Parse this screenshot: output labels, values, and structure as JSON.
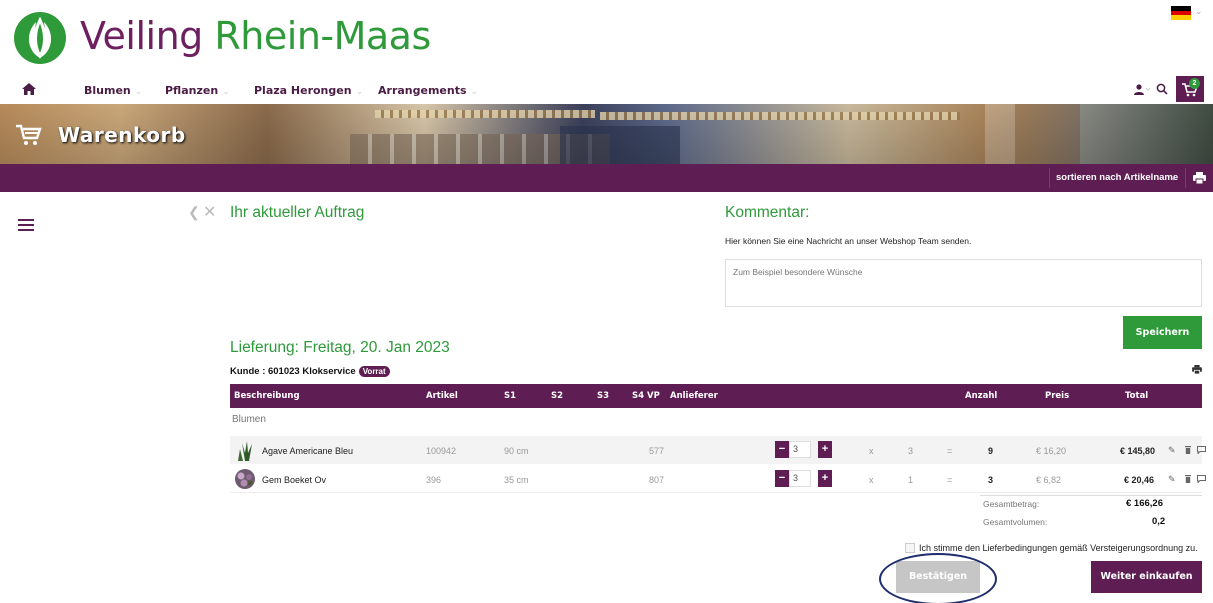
{
  "brand": {
    "part1": "Veiling ",
    "part2": "Rhein-Maas"
  },
  "nav": {
    "items": [
      {
        "label": "Blumen"
      },
      {
        "label": "Pflanzen"
      },
      {
        "label": "Plaza Herongen"
      },
      {
        "label": "Arrangements"
      }
    ],
    "cart_count": "2",
    "icons": [
      "home-icon",
      "user-icon",
      "search-icon",
      "cart-icon",
      "flag-de-icon"
    ]
  },
  "banner": {
    "title": "Warenkorb"
  },
  "toolbar": {
    "sort_label": "sortieren nach Artikelname"
  },
  "order": {
    "title": "Ihr aktueller Auftrag"
  },
  "comment": {
    "title": "Kommentar:",
    "hint": "Hier können Sie eine Nachricht an unser Webshop Team senden.",
    "placeholder": "Zum Beispiel besondere Wünsche",
    "save_label": "Speichern"
  },
  "delivery": {
    "title": "Lieferung: Freitag, 20. Jan 2023",
    "customer": "Kunde : 601023 Klokservice",
    "badge": "Vorrat"
  },
  "table": {
    "headers": {
      "description": "Beschreibung",
      "article": "Artikel",
      "s1": "S1",
      "s2": "S2",
      "s3": "S3",
      "s4vp": "S4 VP",
      "supplier": "Anlieferer",
      "quantity": "Anzahl",
      "price": "Preis",
      "total": "Total"
    },
    "group": "Blumen",
    "rows": [
      {
        "name": "Agave Americane Bleu",
        "article": "100942",
        "s1": "90 cm",
        "supplier": "577",
        "qty_input": "3",
        "x": "x",
        "per": "3",
        "eq": "=",
        "amount": "9",
        "price": "€ 16,20",
        "total": "€ 145,80"
      },
      {
        "name": "Gem Boeket Ov",
        "article": "396",
        "s1": "35 cm",
        "supplier": "807",
        "qty_input": "3",
        "x": "x",
        "per": "1",
        "eq": "=",
        "amount": "3",
        "price": "€ 6,82",
        "total": "€ 20,46"
      }
    ]
  },
  "summary": {
    "total_label": "Gesamtbetrag:",
    "total_value": "€ 166,26",
    "volume_label": "Gesamtvolumen:",
    "volume_value": "0,2"
  },
  "footer": {
    "terms": "Ich stimme den Lieferbedingungen gemäß Versteigerungsordnung zu.",
    "confirm_label": "Bestätigen",
    "continue_label": "Weiter einkaufen"
  },
  "colors": {
    "brand_purple": "#5e1e54",
    "brand_green": "#2f9a3a",
    "disabled_gray": "#c6c6c6",
    "highlight_ring": "#1e2e6e"
  }
}
